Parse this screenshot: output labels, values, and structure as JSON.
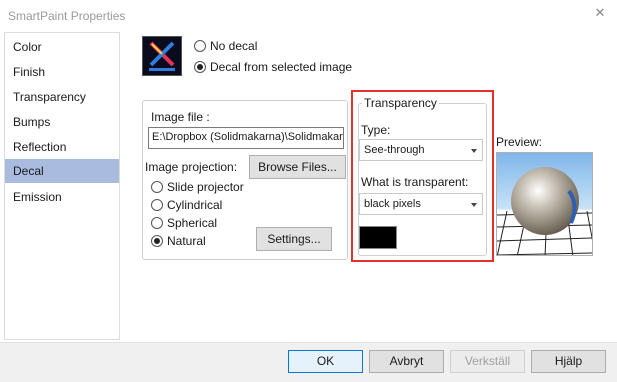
{
  "window": {
    "title": "SmartPaint Properties",
    "close_glyph": "✕"
  },
  "sidebar": {
    "items": [
      {
        "label": "Color"
      },
      {
        "label": "Finish"
      },
      {
        "label": "Transparency"
      },
      {
        "label": "Bumps"
      },
      {
        "label": "Reflection"
      },
      {
        "label": "Decal",
        "selected": true
      },
      {
        "label": "Emission"
      }
    ]
  },
  "decal_mode": {
    "options": [
      {
        "label": "No decal",
        "checked": false
      },
      {
        "label": "Decal from selected image",
        "checked": true
      }
    ]
  },
  "image_group": {
    "image_file_label": "Image file :",
    "image_file_value": "E:\\Dropbox (Solidmakarna)\\Solidmakarn",
    "projection_label": "Image projection:",
    "browse_label": "Browse Files...",
    "settings_label": "Settings...",
    "projections": [
      {
        "label": "Slide projector",
        "checked": false
      },
      {
        "label": "Cylindrical",
        "checked": false
      },
      {
        "label": "Spherical",
        "checked": false
      },
      {
        "label": "Natural",
        "checked": true
      }
    ]
  },
  "transparency_group": {
    "title": "Transparency",
    "type_label": "Type:",
    "type_value": "See-through",
    "what_label": "What is transparent:",
    "what_value": "black pixels",
    "swatch_color": "#000000"
  },
  "preview": {
    "label": "Preview:"
  },
  "footer": {
    "ok_label": "OK",
    "cancel_label": "Avbryt",
    "apply_label": "Verkställ",
    "help_label": "Hjälp"
  },
  "colors": {
    "selected_item": "#a9bcdf",
    "highlight_border": "#e53030",
    "primary_button_border": "#0078d7"
  }
}
